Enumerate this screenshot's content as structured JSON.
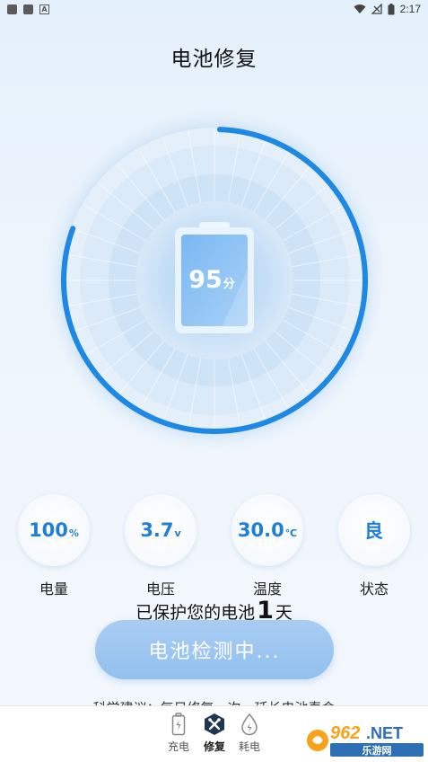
{
  "status_bar": {
    "time": "2:17"
  },
  "page": {
    "title": "电池修复"
  },
  "battery": {
    "score": "95",
    "unit": "分",
    "level_fraction": 0.95
  },
  "stats": [
    {
      "value": "100",
      "unit": "%",
      "label": "电量"
    },
    {
      "value": "3.7",
      "unit": "v",
      "label": "电压"
    },
    {
      "value": "30.0",
      "unit": "℃",
      "label": "温度"
    },
    {
      "value": "良",
      "unit": "",
      "label": "状态"
    }
  ],
  "protect": {
    "prefix": "已保护您的电池",
    "days": "1",
    "suffix": "天"
  },
  "detect_button": {
    "label": "电池检测中..."
  },
  "advice": {
    "text": "科学建议：每日修复一次，延长电池寿命"
  },
  "bottom_nav": {
    "items": [
      {
        "label": "充电",
        "icon": "battery-charge-icon"
      },
      {
        "label": "修复",
        "icon": "repair-tools-icon",
        "active": true
      },
      {
        "label": "耗电",
        "icon": "power-drop-icon"
      }
    ]
  },
  "watermark": {
    "brand": "962.NET",
    "sub": "乐游网"
  },
  "colors": {
    "accent": "#1e88e5",
    "button": "#9fc8f1",
    "stat_value": "#1e7fd6"
  }
}
